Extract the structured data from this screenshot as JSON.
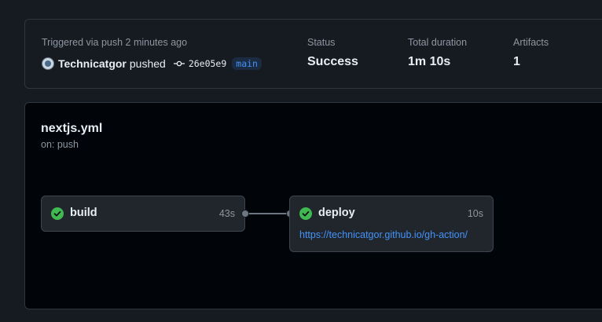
{
  "summary": {
    "trigger_text": "Triggered via push 2 minutes ago",
    "actor": "Technicatgor",
    "action": "pushed",
    "commit_sha": "26e05e9",
    "branch": "main",
    "status": {
      "label": "Status",
      "value": "Success"
    },
    "duration": {
      "label": "Total duration",
      "value": "1m 10s"
    },
    "artifacts": {
      "label": "Artifacts",
      "value": "1"
    }
  },
  "workflow": {
    "name": "nextjs.yml",
    "trigger": "on: push",
    "jobs": [
      {
        "name": "build",
        "duration": "43s",
        "status": "success"
      },
      {
        "name": "deploy",
        "duration": "10s",
        "status": "success",
        "link": "https://technicatgor.github.io/gh-action/"
      }
    ]
  },
  "colors": {
    "success": "#3fb950",
    "link": "#4493f8",
    "muted": "#8d96a0",
    "border": "#30363d"
  },
  "icons": {
    "avatar": "user-avatar",
    "commit": "git-commit-icon",
    "status": "check-circle-fill-icon"
  }
}
